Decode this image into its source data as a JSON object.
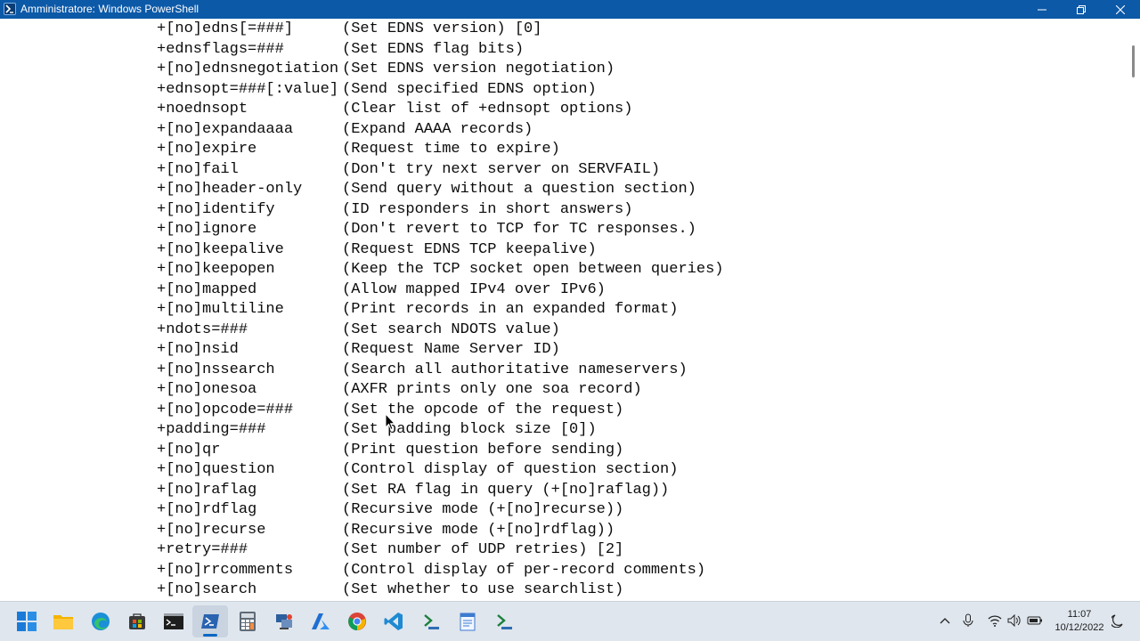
{
  "window": {
    "title": "Amministratore: Windows PowerShell",
    "icon": "powershell-icon",
    "controls": [
      "minimize-icon",
      "maximize-icon",
      "close-icon"
    ]
  },
  "console": {
    "lines": [
      {
        "option": "+[no]edns[=###]",
        "desc": "(Set EDNS version) [0]"
      },
      {
        "option": "+ednsflags=###",
        "desc": "(Set EDNS flag bits)"
      },
      {
        "option": "+[no]ednsnegotiation",
        "desc": "(Set EDNS version negotiation)"
      },
      {
        "option": "+ednsopt=###[:value]",
        "desc": "(Send specified EDNS option)"
      },
      {
        "option": "+noednsopt",
        "desc": "(Clear list of +ednsopt options)"
      },
      {
        "option": "+[no]expandaaaa",
        "desc": "(Expand AAAA records)"
      },
      {
        "option": "+[no]expire",
        "desc": "(Request time to expire)"
      },
      {
        "option": "+[no]fail",
        "desc": "(Don't try next server on SERVFAIL)"
      },
      {
        "option": "+[no]header-only",
        "desc": "(Send query without a question section)"
      },
      {
        "option": "+[no]identify",
        "desc": "(ID responders in short answers)"
      },
      {
        "option": "+[no]ignore",
        "desc": "(Don't revert to TCP for TC responses.)"
      },
      {
        "option": "+[no]keepalive",
        "desc": "(Request EDNS TCP keepalive)"
      },
      {
        "option": "+[no]keepopen",
        "desc": "(Keep the TCP socket open between queries)"
      },
      {
        "option": "+[no]mapped",
        "desc": "(Allow mapped IPv4 over IPv6)"
      },
      {
        "option": "+[no]multiline",
        "desc": "(Print records in an expanded format)"
      },
      {
        "option": "+ndots=###",
        "desc": "(Set search NDOTS value)"
      },
      {
        "option": "+[no]nsid",
        "desc": "(Request Name Server ID)"
      },
      {
        "option": "+[no]nssearch",
        "desc": "(Search all authoritative nameservers)"
      },
      {
        "option": "+[no]onesoa",
        "desc": "(AXFR prints only one soa record)"
      },
      {
        "option": "+[no]opcode=###",
        "desc": "(Set the opcode of the request)"
      },
      {
        "option": "+padding=###",
        "desc": "(Set padding block size [0])"
      },
      {
        "option": "+[no]qr",
        "desc": "(Print question before sending)"
      },
      {
        "option": "+[no]question",
        "desc": "(Control display of question section)"
      },
      {
        "option": "+[no]raflag",
        "desc": "(Set RA flag in query (+[no]raflag))"
      },
      {
        "option": "+[no]rdflag",
        "desc": "(Recursive mode (+[no]recurse))"
      },
      {
        "option": "+[no]recurse",
        "desc": "(Recursive mode (+[no]rdflag))"
      },
      {
        "option": "+retry=###",
        "desc": "(Set number of UDP retries) [2]"
      },
      {
        "option": "+[no]rrcomments",
        "desc": "(Control display of per-record comments)"
      },
      {
        "option": "+[no]search",
        "desc": "(Set whether to use searchlist)"
      }
    ]
  },
  "taskbar": {
    "apps": [
      {
        "name": "start-button",
        "icon": "windows-logo-icon",
        "running": false
      },
      {
        "name": "file-explorer",
        "icon": "folder-icon",
        "running": false
      },
      {
        "name": "edge",
        "icon": "edge-icon",
        "running": false
      },
      {
        "name": "store",
        "icon": "store-icon",
        "running": false
      },
      {
        "name": "command-prompt",
        "icon": "terminal-icon",
        "running": false
      },
      {
        "name": "powershell",
        "icon": "powershell-icon",
        "running": true
      },
      {
        "name": "calculator",
        "icon": "calculator-icon",
        "running": false
      },
      {
        "name": "network-tool",
        "icon": "network-icon",
        "running": false
      },
      {
        "name": "azure-data-studio",
        "icon": "azure-icon",
        "running": false
      },
      {
        "name": "chrome",
        "icon": "chrome-icon",
        "running": false
      },
      {
        "name": "vscode",
        "icon": "vscode-icon",
        "running": false
      },
      {
        "name": "terminal-alt",
        "icon": "terminal-green-icon",
        "running": false
      },
      {
        "name": "notepad",
        "icon": "notepad-icon",
        "running": false
      },
      {
        "name": "terminal-alt-2",
        "icon": "terminal-green-icon",
        "running": false
      }
    ],
    "tray": [
      "chevron-up-icon",
      "microphone-icon",
      "wifi-icon",
      "volume-icon",
      "battery-icon",
      "notification-icon"
    ],
    "clock": {
      "time": "11:07",
      "date": "10/12/2022"
    }
  },
  "colors": {
    "titlebar": "#0c59a8",
    "console_bg": "#ffffff",
    "console_text": "#0c0c0c",
    "taskbar_bg": "#dfe6ee"
  }
}
